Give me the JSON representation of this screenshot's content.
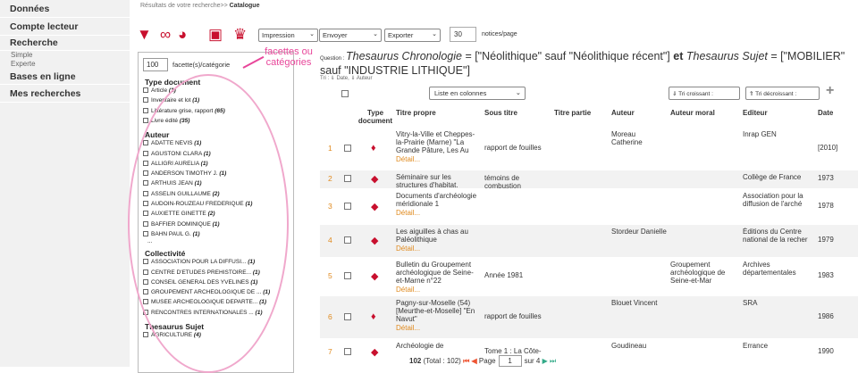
{
  "nav": {
    "items": [
      {
        "label": "Données"
      },
      {
        "label": "Compte lecteur"
      },
      {
        "label": "Recherche",
        "sub": [
          "Simple",
          "Experte"
        ]
      },
      {
        "label": "Bases en ligne"
      },
      {
        "label": "Mes recherches"
      }
    ]
  },
  "breadcrumb": {
    "prefix": "Résultats de votre recherche>> ",
    "current": "Catalogue"
  },
  "toolbar": {
    "impression": "Impression",
    "envoyer": "Envoyer",
    "exporter": "Exporter",
    "per_page": "30",
    "per_page_label": "notices/page"
  },
  "facets": {
    "count": "100",
    "count_label": "facette(s)/catégorie",
    "groups": [
      {
        "title": "Type document",
        "items": [
          {
            "label": "Article",
            "n": "(1)"
          },
          {
            "label": "Inventaire et lot",
            "n": "(1)"
          },
          {
            "label": "Littérature grise, rapport",
            "n": "(65)"
          },
          {
            "label": "Livre édité",
            "n": "(35)"
          }
        ]
      },
      {
        "title": "Auteur",
        "items": [
          {
            "label": "ADATTE NEVIS",
            "n": "(1)"
          },
          {
            "label": "AGUSTONI CLARA",
            "n": "(1)"
          },
          {
            "label": "ALLIGRI AURELIA",
            "n": "(1)"
          },
          {
            "label": "ANDERSON TIMOTHY J.",
            "n": "(1)"
          },
          {
            "label": "ARTHUIS JEAN",
            "n": "(1)"
          },
          {
            "label": "ASSELIN GUILLAUME",
            "n": "(2)"
          },
          {
            "label": "AUDOIN-ROUZEAU FREDERIQUE",
            "n": "(1)"
          },
          {
            "label": "AUXIETTE GINETTE",
            "n": "(2)"
          },
          {
            "label": "BAFFIER DOMINIQUE",
            "n": "(1)"
          },
          {
            "label": "BAHN PAUL G.",
            "n": "(1)"
          }
        ],
        "more": "..."
      },
      {
        "title": "Collectivité",
        "items": [
          {
            "label": "ASSOCIATION POUR LA DIFFUSI...",
            "n": "(1)"
          },
          {
            "label": "CENTRE D'ETUDES PREHISTOIRE...",
            "n": "(1)"
          },
          {
            "label": "CONSEIL GENERAL DES YVELINES",
            "n": "(1)"
          },
          {
            "label": "GROUPEMENT ARCHEOLOGIQUE DE ...",
            "n": "(1)"
          },
          {
            "label": "MUSEE ARCHEOLOGIQUE DEPARTE...",
            "n": "(1)"
          },
          {
            "label": "RENCONTRES INTERNATIONALES ...",
            "n": "(1)"
          }
        ]
      },
      {
        "title": "Thesaurus Sujet",
        "items": [
          {
            "label": "AGRICULTURE",
            "n": "(4)"
          }
        ]
      }
    ]
  },
  "annotation": "facettes ou catégories",
  "query": {
    "label": "Question : ",
    "t1": "Thesaurus Chronologie",
    "p1": " = [\"Néolithique\" sauf \"Néolithique récent\"] ",
    "and": "et",
    "t2": " Thesaurus Sujet",
    "p2": " = [\"MOBILIER\" sauf \"INDUSTRIE LITHIQUE\"]"
  },
  "sort_line": "Tri : ⇓ Date, ⇓ Auteur",
  "list_mode": "Liste en colonnes",
  "sort_asc": "⇓ Tri croissant :",
  "sort_desc": "⇑ Tri décroissant :",
  "columns": {
    "type": "Type document",
    "titre": "Titre propre",
    "sous_titre": "Sous titre",
    "partie": "Titre partie",
    "auteur": "Auteur",
    "auteur_moral": "Auteur moral",
    "editeur": "Editeur",
    "date": "Date"
  },
  "rows": [
    {
      "n": "1",
      "titre": "Vitry-la-Ville et Cheppes-la-Prairie (Marne) \"La Grande Pâture, Les Au",
      "sous": "rapport de fouilles",
      "auteur": "Moreau Catherine",
      "moral": "",
      "editeur": "Inrap GEN",
      "date": "[2010]",
      "detail": "Détail...",
      "icon": "award-icon"
    },
    {
      "n": "2",
      "titre": "Séminaire sur les structures d'habitat.",
      "sous": "témoins de combustion",
      "auteur": "",
      "moral": "",
      "editeur": "Collège de France",
      "date": "1973",
      "detail": "",
      "icon": "book-icon"
    },
    {
      "n": "3",
      "titre": "Documents d'archéologie méridionale 1",
      "sous": "",
      "auteur": "",
      "moral": "",
      "editeur": "Association pour la diffusion de l'arché",
      "date": "1978",
      "detail": "Détail...",
      "icon": "book-icon"
    },
    {
      "n": "4",
      "titre": "Les aiguilles à chas au Paléolithique",
      "sous": "",
      "auteur": "Stordeur Danielle",
      "moral": "",
      "editeur": "Éditions du Centre national de la recher",
      "date": "1979",
      "detail": "Détail...",
      "icon": "book-icon"
    },
    {
      "n": "5",
      "titre": "Bulletin du Groupement archéologique de Seine-et-Marne n°22",
      "sous": "Année 1981",
      "auteur": "",
      "moral": "Groupement archéologique de Seine-et-Mar",
      "editeur": "Archives départementales",
      "date": "1983",
      "detail": "Détail...",
      "icon": "book-icon"
    },
    {
      "n": "6",
      "titre": "Pagny-sur-Moselle (54) [Meurthe-et-Moselle] \"En Navut\"",
      "sous": "rapport de fouilles",
      "auteur": "Blouet Vincent",
      "moral": "",
      "editeur": "SRA",
      "date": "1986",
      "detail": "Détail...",
      "icon": "award-icon"
    },
    {
      "n": "7",
      "titre": "Archéologie de",
      "sous": "Tome 1 : La Côte-",
      "auteur": "Goudineau",
      "moral": "",
      "editeur": "Errance",
      "date": "1990",
      "detail": "",
      "icon": "book-icon"
    }
  ],
  "pager": {
    "total": "102",
    "total_label": "(Total : 102)",
    "page_label": "Page",
    "page": "1",
    "of": "sur 4"
  }
}
